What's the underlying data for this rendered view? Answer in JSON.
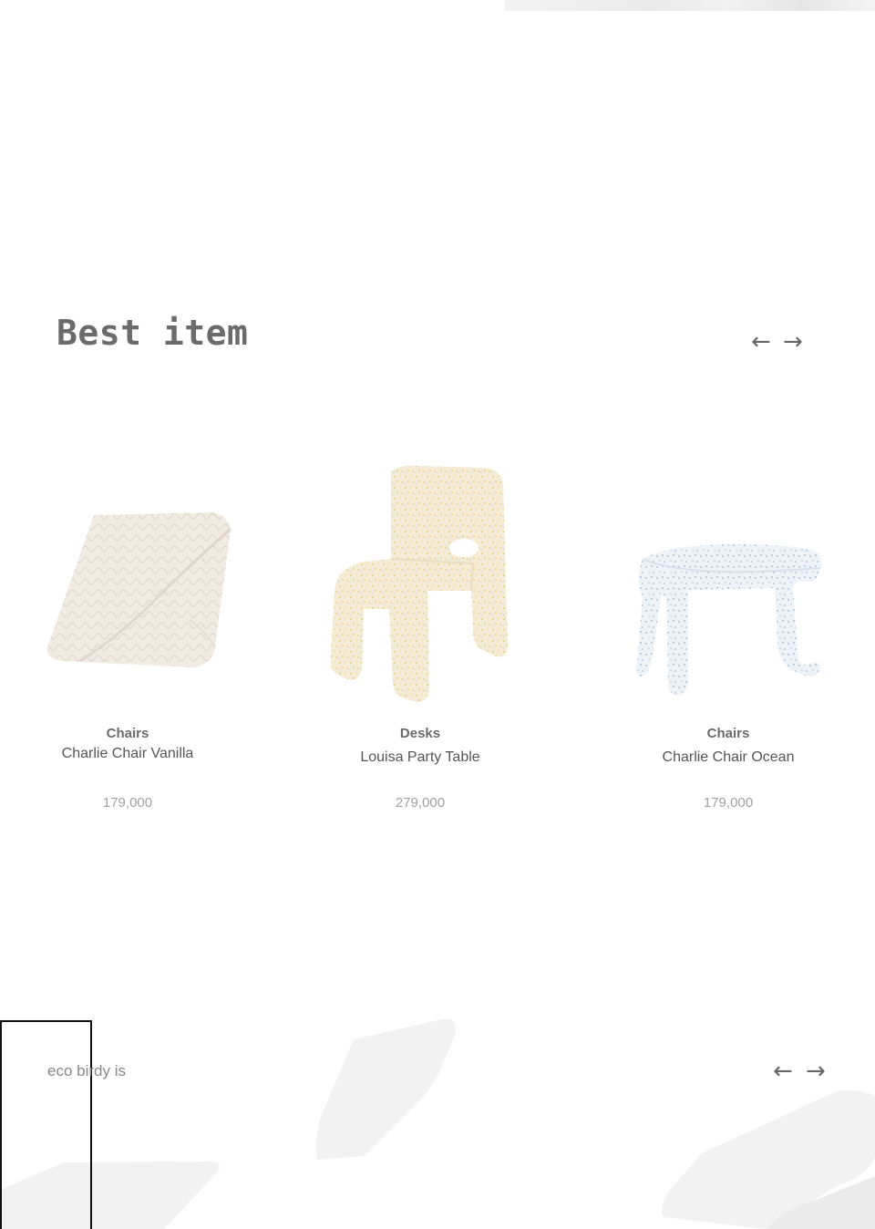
{
  "best_section": {
    "title": "Best item",
    "prev_arrow": "←",
    "next_arrow": "→"
  },
  "products": [
    {
      "category": "Chairs",
      "name": "Charlie Chair Vanilla",
      "price": "179,000",
      "image": "knit-blanket"
    },
    {
      "category": "Desks",
      "name": "Louisa Party Table",
      "price": "279,000",
      "image": "speckled-yellow-chair"
    },
    {
      "category": "Chairs",
      "name": "Charlie Chair Ocean",
      "price": "179,000",
      "image": "speckled-blue-table"
    }
  ],
  "eco_section": {
    "text": "eco birdy is",
    "prev_arrow": "←",
    "next_arrow": "→"
  },
  "colors": {
    "background": "#ffffff",
    "title": "#6b6b6b",
    "price": "#a0a0a0",
    "shape": "#f2f2f2"
  }
}
